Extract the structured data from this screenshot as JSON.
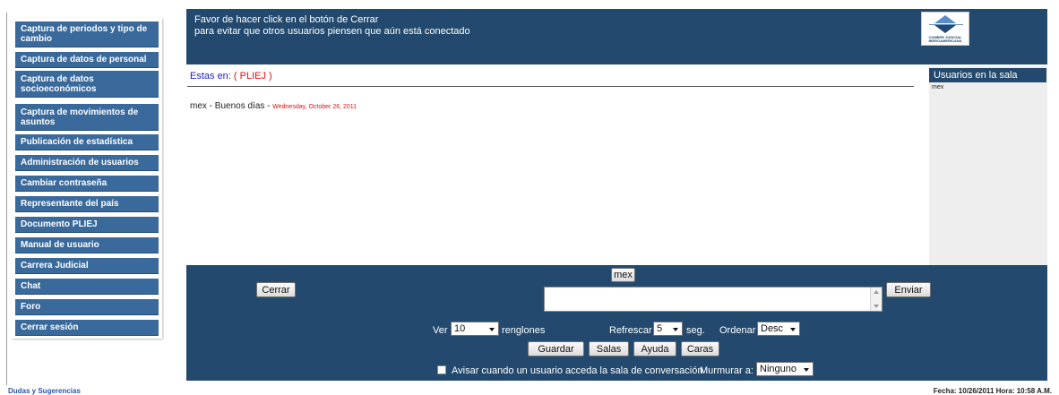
{
  "sidebar": {
    "items": [
      {
        "label": "Captura de periodos y tipo de cambio"
      },
      {
        "label": "Captura de datos de personal"
      },
      {
        "label": "Captura de datos socioeconómicos"
      },
      {
        "label": "Captura de movimientos de asuntos"
      },
      {
        "label": "Publicación de estadística"
      },
      {
        "label": "Administración de usuarios"
      },
      {
        "label": "Cambiar contraseña"
      },
      {
        "label": "Representante del país"
      },
      {
        "label": "Documento PLIEJ"
      },
      {
        "label": "Manual de usuario"
      },
      {
        "label": "Carrera Judicial"
      },
      {
        "label": "Chat"
      },
      {
        "label": "Foro"
      },
      {
        "label": "Cerrar sesión"
      }
    ]
  },
  "banner": {
    "line1": "Favor de hacer click en el botón de Cerrar",
    "line2": "para evitar que otros usuarios piensen que aún está conectado",
    "logo_text_1": "CUMBRE JUDICIAL",
    "logo_text_2": "IBEROAMERICANA"
  },
  "main": {
    "location_prefix": "Estas en: ",
    "location_value": "( PLIEJ )",
    "greeting": "mex - Buenos días - ",
    "greeting_date": "Wednesday, October 26, 2011"
  },
  "users": {
    "title": "Usuarios en la sala",
    "list": [
      "mex"
    ]
  },
  "chat": {
    "user_tag": "mex",
    "close_label": "Cerrar",
    "send_label": "Enviar",
    "message_value": "",
    "ver_label": "Ver",
    "ver_value": "10",
    "renglones_label": "renglones",
    "refrescar_label": "Refrescar",
    "refrescar_value": "5",
    "seg_label": "seg.",
    "ordenar_label": "Ordenar",
    "ordenar_value": "Desc",
    "guardar_label": "Guardar",
    "salas_label": "Salas",
    "ayuda_label": "Ayuda",
    "caras_label": "Caras",
    "avisar_label": "Avisar cuando un usuario acceda la sala de conversación",
    "avisar_checked": false,
    "murmurar_label": "Murmurar a:",
    "murmurar_value": "Ninguno"
  },
  "footer": {
    "link": "Dudas y Sugerencias",
    "datetime": "Fecha: 10/26/2011 Hora: 10:58 A.M."
  },
  "colors": {
    "navy": "#234a6e",
    "menu_blue": "#3a6a9c",
    "red": "#e01010",
    "link_blue": "#2222cc"
  }
}
